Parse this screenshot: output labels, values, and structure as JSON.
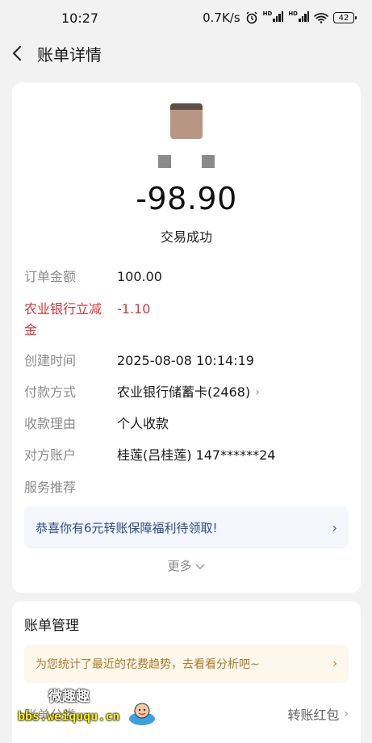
{
  "status_bar": {
    "time": "10:27",
    "speed": "0.7K/s",
    "battery": "42"
  },
  "nav": {
    "title": "账单详情"
  },
  "transaction": {
    "amount": "-98.90",
    "status": "交易成功",
    "rows": [
      {
        "label": "订单金额",
        "value": "100.00"
      },
      {
        "label": "农业银行立减",
        "label2": "金",
        "value": "-1.10"
      },
      {
        "label": "创建时间",
        "value": "2025-08-08 10:14:19"
      },
      {
        "label": "付款方式",
        "value": "农业银行储蓄卡(2468)"
      },
      {
        "label": "收款理由",
        "value": "个人收款"
      },
      {
        "label": "对方账户",
        "value": "桂莲(吕桂莲) 147******24"
      },
      {
        "label": "服务推荐",
        "value": ""
      }
    ],
    "promo": "恭喜你有6元转账保障福利待领取!",
    "more": "更多"
  },
  "management": {
    "title": "账单管理",
    "tip": "为您统计了最近的花费趋势，去看看分析吧~",
    "category_label": "账单分类",
    "category_value": "转账红包"
  },
  "watermark": {
    "top": "微趣趣",
    "bottom": "bbs.weiququ.cn"
  },
  "colors": {
    "accent_red": "#d0363a",
    "promo_blue": "#2a4e8a",
    "tip_orange": "#b07b24"
  }
}
